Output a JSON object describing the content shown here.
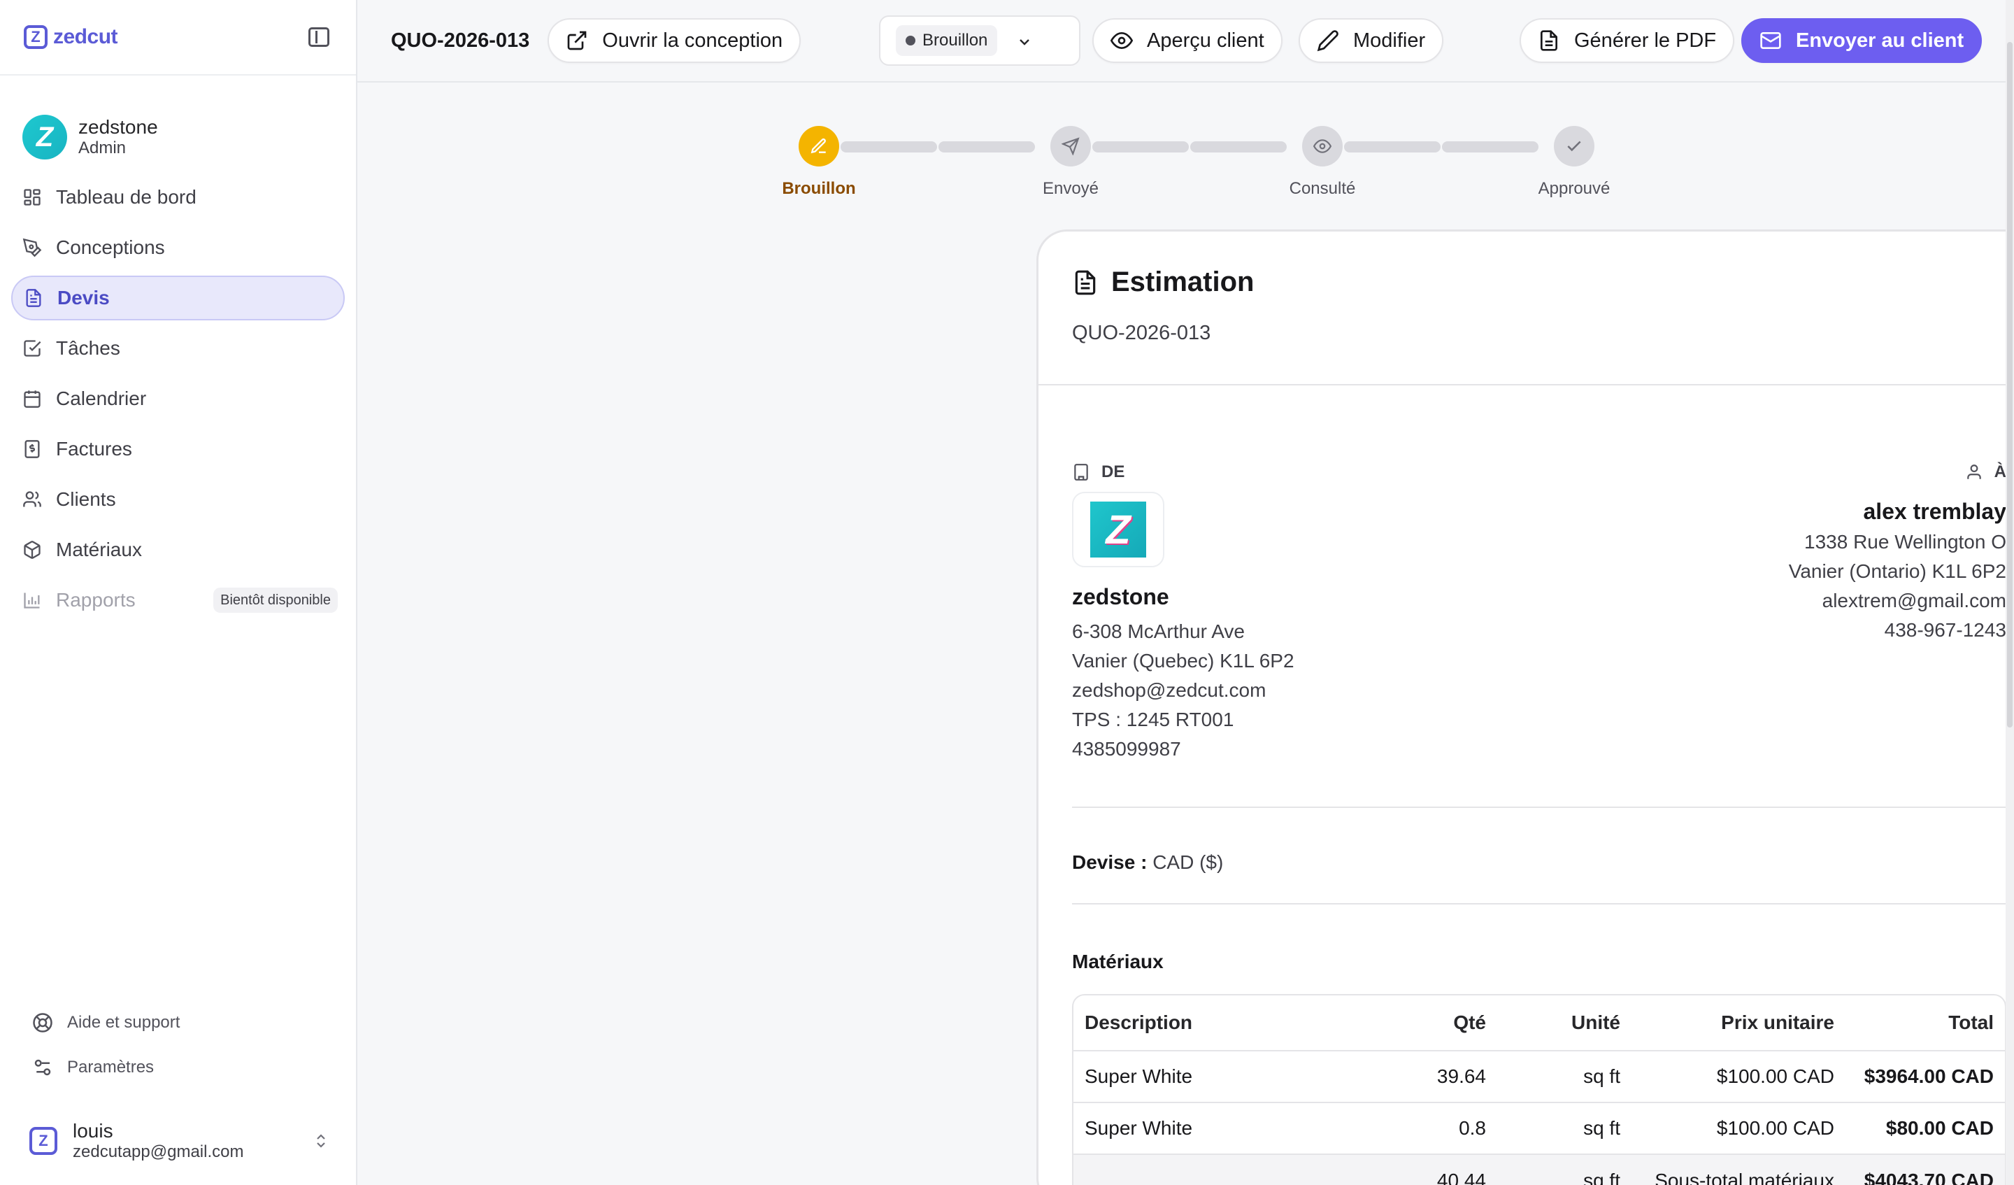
{
  "brand": {
    "name": "zedcut",
    "mark": "Z"
  },
  "sidebar": {
    "user": {
      "name": "zedstone",
      "role": "Admin",
      "avatar_letter": "Z"
    },
    "items": [
      {
        "label": "Tableau de bord",
        "icon": "dashboard-icon"
      },
      {
        "label": "Conceptions",
        "icon": "pen-tool-icon"
      },
      {
        "label": "Devis",
        "icon": "document-icon",
        "active": true
      },
      {
        "label": "Tâches",
        "icon": "checkbox-icon"
      },
      {
        "label": "Calendrier",
        "icon": "calendar-icon"
      },
      {
        "label": "Factures",
        "icon": "dollar-receipt-icon"
      },
      {
        "label": "Clients",
        "icon": "users-icon"
      },
      {
        "label": "Matériaux",
        "icon": "box-icon"
      },
      {
        "label": "Rapports",
        "icon": "bar-chart-icon",
        "disabled": true,
        "badge": "Bientôt disponible"
      }
    ],
    "help_label": "Aide et support",
    "settings_label": "Paramètres",
    "account": {
      "name": "louis",
      "email": "zedcutapp@gmail.com"
    }
  },
  "topbar": {
    "quote_id": "QUO-2026-013",
    "open_design_label": "Ouvrir la conception",
    "status_value": "Brouillon",
    "preview_label": "Aperçu client",
    "edit_label": "Modifier",
    "pdf_label": "Générer le PDF",
    "send_label": "Envoyer au client",
    "accent_color": "#6d5ef0"
  },
  "stepper": {
    "steps": [
      {
        "label": "Brouillon",
        "icon": "edit-icon",
        "current": true
      },
      {
        "label": "Envoyé",
        "icon": "send-icon"
      },
      {
        "label": "Consulté",
        "icon": "eye-icon"
      },
      {
        "label": "Approuvé",
        "icon": "check-icon"
      }
    ],
    "current_color": "#f4b400"
  },
  "quote": {
    "title": "Estimation",
    "number": "QUO-2026-013",
    "from": {
      "label": "DE",
      "name": "zedstone",
      "logo_letter": "Z",
      "address1": "6-308 McArthur Ave",
      "address2": "Vanier (Quebec) K1L 6P2",
      "email": "zedshop@zedcut.com",
      "tax": "TPS : 1245 RT001",
      "phone": "4385099987"
    },
    "to": {
      "label": "À",
      "name": "alex tremblay",
      "address1": "1338 Rue Wellington O",
      "address2": "Vanier (Ontario) K1L 6P2",
      "email": "alextrem@gmail.com",
      "phone": "438-967-1243"
    },
    "currency_label": "Devise :",
    "currency_value": "CAD ($)",
    "materials_title": "Matériaux",
    "table": {
      "headers": {
        "description": "Description",
        "qty": "Qté",
        "unit": "Unité",
        "unit_price": "Prix unitaire",
        "total": "Total"
      },
      "rows": [
        {
          "description": "Super White",
          "qty": "39.64",
          "unit": "sq ft",
          "unit_price": "$100.00 CAD",
          "total": "$3964.00 CAD"
        },
        {
          "description": "Super White",
          "qty": "0.8",
          "unit": "sq ft",
          "unit_price": "$100.00 CAD",
          "total": "$80.00 CAD"
        }
      ],
      "subtotal": {
        "qty": "40.44",
        "unit": "sq ft",
        "label": "Sous-total matériaux",
        "total": "$4043.70 CAD"
      }
    }
  }
}
